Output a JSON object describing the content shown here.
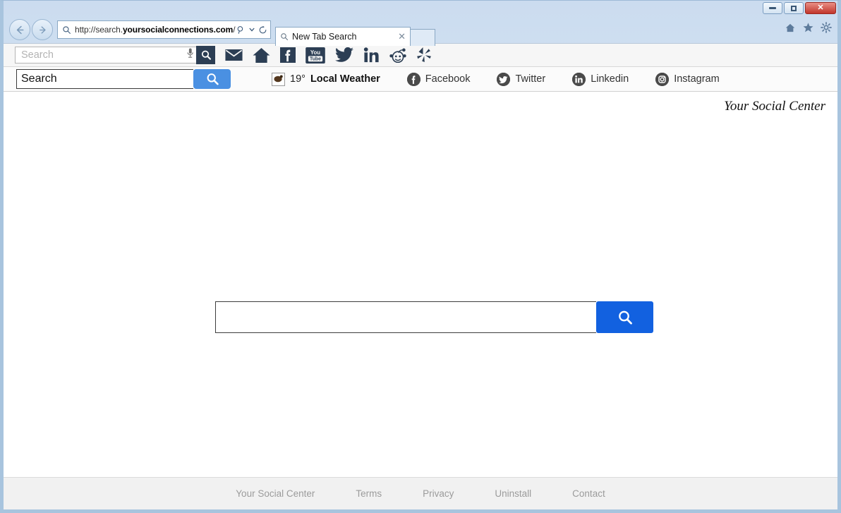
{
  "window": {
    "controls": [
      {
        "name": "minimize",
        "glyph": "—"
      },
      {
        "name": "restore",
        "glyph": "❐"
      },
      {
        "name": "close",
        "glyph": "✕"
      }
    ]
  },
  "browser": {
    "back_label": "Back",
    "forward_label": "Forward",
    "address": {
      "url_prefix": "http://search.",
      "url_domain": "yoursocialconnections.com",
      "url_suffix": "/",
      "search_icon": "search-icon",
      "dropdown_icon": "chevron-down-icon",
      "refresh_icon": "refresh-icon"
    },
    "tab": {
      "title": "New Tab Search",
      "close_glyph": "✕",
      "favicon": "search-icon"
    },
    "newtab_label": "",
    "right_icons": [
      {
        "name": "home-icon",
        "glyph": "⌂"
      },
      {
        "name": "favorites-icon",
        "glyph": "★"
      },
      {
        "name": "settings-gear-icon",
        "glyph": "⚙"
      }
    ]
  },
  "toolbar1": {
    "search_placeholder": "Search",
    "mic_icon": "microphone-icon",
    "go_icon": "search-icon",
    "icons": [
      {
        "name": "mail-icon",
        "label": "Mail"
      },
      {
        "name": "home-icon",
        "label": "Home"
      },
      {
        "name": "facebook-icon",
        "label": "Facebook"
      },
      {
        "name": "youtube-icon",
        "label": "YouTube",
        "top": "You",
        "bottom": "Tube"
      },
      {
        "name": "twitter-icon",
        "label": "Twitter"
      },
      {
        "name": "linkedin-icon",
        "label": "LinkedIn",
        "glyph": "in"
      },
      {
        "name": "reddit-icon",
        "label": "Reddit"
      },
      {
        "name": "yelp-icon",
        "label": "Yelp"
      }
    ]
  },
  "toolbar2": {
    "search_value": "Search",
    "search_placeholder": "Search",
    "go_icon": "search-icon",
    "weather": {
      "temperature": "19°",
      "label": "Local Weather",
      "icon": "weather-icon"
    },
    "links": [
      {
        "name": "facebook",
        "label": "Facebook",
        "glyph": "f"
      },
      {
        "name": "twitter",
        "label": "Twitter",
        "glyph": "t"
      },
      {
        "name": "linkedin",
        "label": "Linkedin",
        "glyph": "in"
      },
      {
        "name": "instagram",
        "label": "Instagram",
        "glyph": "◉"
      }
    ]
  },
  "page": {
    "brand": "Your Social Center",
    "search_value": "",
    "search_placeholder": "",
    "search_button_icon": "search-icon",
    "accent_color": "#1261e0"
  },
  "footer": {
    "links": [
      {
        "label": "Your Social Center"
      },
      {
        "label": "Terms"
      },
      {
        "label": "Privacy"
      },
      {
        "label": "Uninstall"
      },
      {
        "label": "Contact"
      }
    ]
  }
}
